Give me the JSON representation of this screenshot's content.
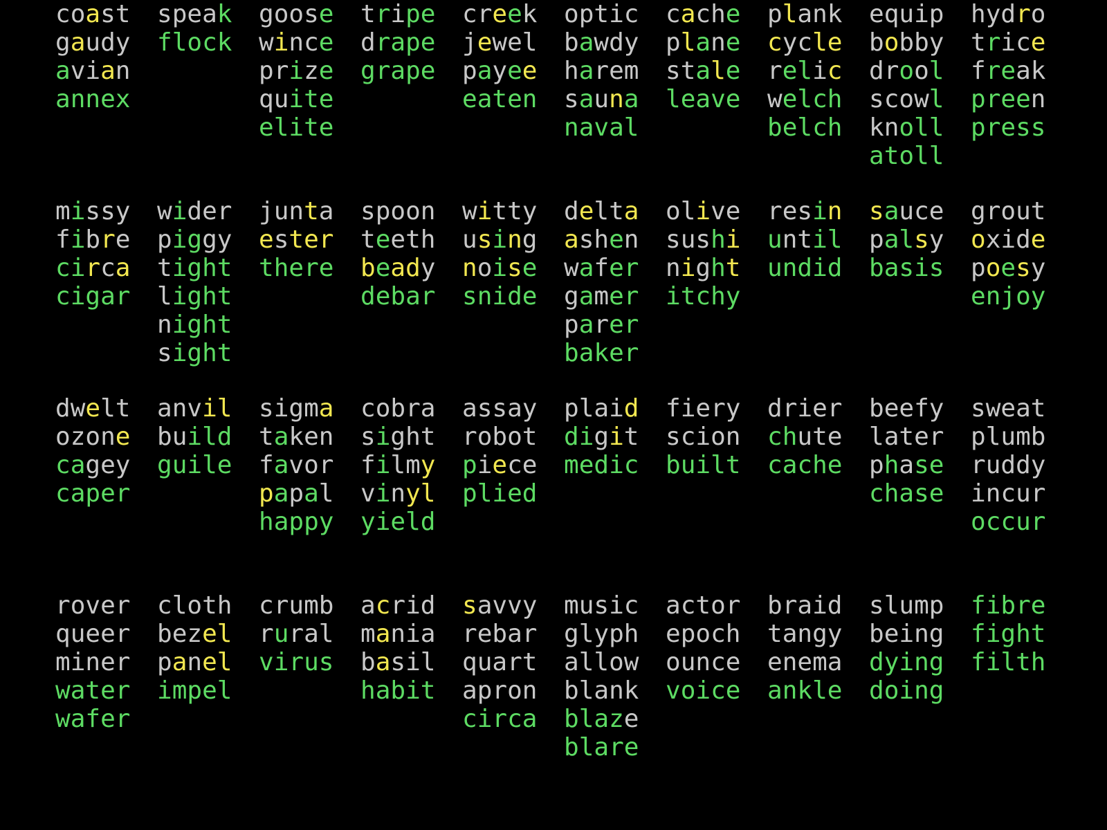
{
  "app": {
    "type": "wordle-solver-word-grid",
    "background_color": "#000000",
    "columns_per_block": 10,
    "blocks": 4
  },
  "legend": {
    "green_color": "#5ddb63",
    "yellow_color": "#f2e750",
    "gray_color": "#c8c8c8",
    "green_meaning": "correct letter correct position",
    "yellow_meaning": "correct letter wrong position",
    "gray_meaning": "letter not in word"
  },
  "blocks": [
    {
      "index": 1,
      "columns": [
        {
          "words": [
            {
              "text": "coast",
              "marks": "nnynn"
            },
            {
              "text": "gaudy",
              "marks": "nynnn"
            },
            {
              "text": "avian",
              "marks": "gnnyn"
            },
            {
              "text": "annex",
              "marks": "ggggg"
            }
          ]
        },
        {
          "words": [
            {
              "text": "speak",
              "marks": "nnnng"
            },
            {
              "text": "flock",
              "marks": "ggggg"
            }
          ]
        },
        {
          "words": [
            {
              "text": "goose",
              "marks": "nnnng"
            },
            {
              "text": "wince",
              "marks": "nynng"
            },
            {
              "text": "prize",
              "marks": "nngng"
            },
            {
              "text": "quite",
              "marks": "nnggg"
            },
            {
              "text": "elite",
              "marks": "ggggg"
            }
          ]
        },
        {
          "words": [
            {
              "text": "tripe",
              "marks": "ngngg"
            },
            {
              "text": "drape",
              "marks": "ngggg"
            },
            {
              "text": "grape",
              "marks": "ggggg"
            }
          ]
        },
        {
          "words": [
            {
              "text": "creek",
              "marks": "nnygn"
            },
            {
              "text": "jewel",
              "marks": "nynnn"
            },
            {
              "text": "payee",
              "marks": "ngngy"
            },
            {
              "text": "eaten",
              "marks": "ggggg"
            }
          ]
        },
        {
          "words": [
            {
              "text": "optic",
              "marks": "nnnnn"
            },
            {
              "text": "bawdy",
              "marks": "ngnnn"
            },
            {
              "text": "harem",
              "marks": "ngnnn"
            },
            {
              "text": "sauna",
              "marks": "ngnyg"
            },
            {
              "text": "naval",
              "marks": "ggggg"
            }
          ]
        },
        {
          "words": [
            {
              "text": "cache",
              "marks": "nynng"
            },
            {
              "text": "plane",
              "marks": "nygng"
            },
            {
              "text": "stale",
              "marks": "nngyg"
            },
            {
              "text": "leave",
              "marks": "ggggg"
            }
          ]
        },
        {
          "words": [
            {
              "text": "plank",
              "marks": "nynnn"
            },
            {
              "text": "cycle",
              "marks": "ynnyy"
            },
            {
              "text": "relic",
              "marks": "nggny"
            },
            {
              "text": "welch",
              "marks": "ngggg"
            },
            {
              "text": "belch",
              "marks": "ggggg"
            }
          ]
        },
        {
          "words": [
            {
              "text": "equip",
              "marks": "nnnnn"
            },
            {
              "text": "bobby",
              "marks": "nynnn"
            },
            {
              "text": "drool",
              "marks": "nngng"
            },
            {
              "text": "scowl",
              "marks": "nnnng"
            },
            {
              "text": "knoll",
              "marks": "nnggg"
            },
            {
              "text": "atoll",
              "marks": "ggggg"
            }
          ]
        },
        {
          "words": [
            {
              "text": "hydro",
              "marks": "nnnyn"
            },
            {
              "text": "trice",
              "marks": "ngnny"
            },
            {
              "text": "freak",
              "marks": "nggnn"
            },
            {
              "text": "preen",
              "marks": "ggggn"
            },
            {
              "text": "press",
              "marks": "ggggg"
            }
          ]
        }
      ]
    },
    {
      "index": 2,
      "columns": [
        {
          "words": [
            {
              "text": "missy",
              "marks": "ngnnn"
            },
            {
              "text": "fibre",
              "marks": "ngnyn"
            },
            {
              "text": "circa",
              "marks": "ggyny"
            },
            {
              "text": "cigar",
              "marks": "ggggg"
            }
          ]
        },
        {
          "words": [
            {
              "text": "wider",
              "marks": "ngnnn"
            },
            {
              "text": "piggy",
              "marks": "nggnn"
            },
            {
              "text": "tight",
              "marks": "ngggg"
            },
            {
              "text": "light",
              "marks": "ngggg"
            },
            {
              "text": "night",
              "marks": "ngggg"
            },
            {
              "text": "sight",
              "marks": "ngggg"
            }
          ]
        },
        {
          "words": [
            {
              "text": "junta",
              "marks": "nnnyn"
            },
            {
              "text": "ester",
              "marks": "ynyyy"
            },
            {
              "text": "there",
              "marks": "ggggg"
            }
          ]
        },
        {
          "words": [
            {
              "text": "spoon",
              "marks": "nnnnn"
            },
            {
              "text": "teeth",
              "marks": "ngnnn"
            },
            {
              "text": "beady",
              "marks": "ygyyn"
            },
            {
              "text": "debar",
              "marks": "ggggg"
            }
          ]
        },
        {
          "words": [
            {
              "text": "witty",
              "marks": "nynnn"
            },
            {
              "text": "using",
              "marks": "nygyn"
            },
            {
              "text": "noise",
              "marks": "yngyg"
            },
            {
              "text": "snide",
              "marks": "ggggg"
            }
          ]
        },
        {
          "words": [
            {
              "text": "delta",
              "marks": "nynny"
            },
            {
              "text": "ashen",
              "marks": "ynngn"
            },
            {
              "text": "wafer",
              "marks": "ngngg"
            },
            {
              "text": "gamer",
              "marks": "ngngg"
            },
            {
              "text": "parer",
              "marks": "ngngg"
            },
            {
              "text": "baker",
              "marks": "ggggg"
            }
          ]
        },
        {
          "words": [
            {
              "text": "olive",
              "marks": "nnynn"
            },
            {
              "text": "sushi",
              "marks": "nnngy"
            },
            {
              "text": "night",
              "marks": "nyngy"
            },
            {
              "text": "itchy",
              "marks": "ggggg"
            }
          ]
        },
        {
          "words": [
            {
              "text": "resin",
              "marks": "nnngy"
            },
            {
              "text": "until",
              "marks": "gnngg"
            },
            {
              "text": "undid",
              "marks": "ggggg"
            }
          ]
        },
        {
          "words": [
            {
              "text": "sauce",
              "marks": "ygnnn"
            },
            {
              "text": "palsy",
              "marks": "nggyn"
            },
            {
              "text": "basis",
              "marks": "ggggg"
            }
          ]
        },
        {
          "words": [
            {
              "text": "grout",
              "marks": "nnnnn"
            },
            {
              "text": "oxide",
              "marks": "ynnny"
            },
            {
              "text": "poesy",
              "marks": "nygyn"
            },
            {
              "text": "enjoy",
              "marks": "ggggg"
            }
          ]
        }
      ]
    },
    {
      "index": 3,
      "columns": [
        {
          "words": [
            {
              "text": "dwelt",
              "marks": "nnynn"
            },
            {
              "text": "ozone",
              "marks": "nnnny"
            },
            {
              "text": "cagey",
              "marks": "ggnnn"
            },
            {
              "text": "caper",
              "marks": "ggggg"
            }
          ]
        },
        {
          "words": [
            {
              "text": "anvil",
              "marks": "nnnyy"
            },
            {
              "text": "build",
              "marks": "nnggg"
            },
            {
              "text": "guile",
              "marks": "ggggg"
            }
          ]
        },
        {
          "words": [
            {
              "text": "sigma",
              "marks": "nnnny"
            },
            {
              "text": "taken",
              "marks": "ngnnn"
            },
            {
              "text": "favor",
              "marks": "ngnnn"
            },
            {
              "text": "papal",
              "marks": "ygngn"
            },
            {
              "text": "happy",
              "marks": "ggggg"
            }
          ]
        },
        {
          "words": [
            {
              "text": "cobra",
              "marks": "nnnnn"
            },
            {
              "text": "sight",
              "marks": "ngnnn"
            },
            {
              "text": "filmy",
              "marks": "ngnny"
            },
            {
              "text": "vinyl",
              "marks": "ngnyy"
            },
            {
              "text": "yield",
              "marks": "ggggg"
            }
          ]
        },
        {
          "words": [
            {
              "text": "assay",
              "marks": "nnnnn"
            },
            {
              "text": "robot",
              "marks": "nnnnn"
            },
            {
              "text": "piece",
              "marks": "gnynn"
            },
            {
              "text": "plied",
              "marks": "ggggg"
            }
          ]
        },
        {
          "words": [
            {
              "text": "plaid",
              "marks": "nnnny"
            },
            {
              "text": "digit",
              "marks": "ggnyn"
            },
            {
              "text": "medic",
              "marks": "ggggg"
            }
          ]
        },
        {
          "words": [
            {
              "text": "fiery",
              "marks": "nnnnn"
            },
            {
              "text": "scion",
              "marks": "nnnnn"
            },
            {
              "text": "built",
              "marks": "ggggg"
            }
          ]
        },
        {
          "words": [
            {
              "text": "drier",
              "marks": "nnnnn"
            },
            {
              "text": "chute",
              "marks": "ggnnn"
            },
            {
              "text": "cache",
              "marks": "ggggg"
            }
          ]
        },
        {
          "words": [
            {
              "text": "beefy",
              "marks": "nnnnn"
            },
            {
              "text": "later",
              "marks": "nnnnn"
            },
            {
              "text": "phase",
              "marks": "ngngg"
            },
            {
              "text": "chase",
              "marks": "ggggg"
            }
          ]
        },
        {
          "words": [
            {
              "text": "sweat",
              "marks": "nnnnn"
            },
            {
              "text": "plumb",
              "marks": "nnnnn"
            },
            {
              "text": "ruddy",
              "marks": "nnnnn"
            },
            {
              "text": "incur",
              "marks": "nnnnn"
            },
            {
              "text": "occur",
              "marks": "ggggg"
            }
          ]
        }
      ]
    },
    {
      "index": 4,
      "columns": [
        {
          "words": [
            {
              "text": "rover",
              "marks": "nnnnn"
            },
            {
              "text": "queer",
              "marks": "nnnnn"
            },
            {
              "text": "miner",
              "marks": "nnnnn"
            },
            {
              "text": "water",
              "marks": "ggggg"
            },
            {
              "text": "wafer",
              "marks": "ggggg"
            }
          ]
        },
        {
          "words": [
            {
              "text": "cloth",
              "marks": "nnnnn"
            },
            {
              "text": "bezel",
              "marks": "nnnyy"
            },
            {
              "text": "panel",
              "marks": "nynyy"
            },
            {
              "text": "impel",
              "marks": "ggggg"
            }
          ]
        },
        {
          "words": [
            {
              "text": "crumb",
              "marks": "nnnnn"
            },
            {
              "text": "rural",
              "marks": "ngnnn"
            },
            {
              "text": "virus",
              "marks": "ggggg"
            }
          ]
        },
        {
          "words": [
            {
              "text": "acrid",
              "marks": "nynnn"
            },
            {
              "text": "mania",
              "marks": "nynnn"
            },
            {
              "text": "basil",
              "marks": "nynnn"
            },
            {
              "text": "habit",
              "marks": "ggggg"
            }
          ]
        },
        {
          "words": [
            {
              "text": "savvy",
              "marks": "ynnnn"
            },
            {
              "text": "rebar",
              "marks": "nnnnn"
            },
            {
              "text": "quart",
              "marks": "nnnnn"
            },
            {
              "text": "apron",
              "marks": "nnnnn"
            },
            {
              "text": "circa",
              "marks": "ggggg"
            }
          ]
        },
        {
          "words": [
            {
              "text": "music",
              "marks": "nnnnn"
            },
            {
              "text": "glyph",
              "marks": "nnnnn"
            },
            {
              "text": "allow",
              "marks": "nnnnn"
            },
            {
              "text": "blank",
              "marks": "nnnnn"
            },
            {
              "text": "blaze",
              "marks": "ggggn"
            },
            {
              "text": "blare",
              "marks": "ggggg"
            }
          ]
        },
        {
          "words": [
            {
              "text": "actor",
              "marks": "nnnnn"
            },
            {
              "text": "epoch",
              "marks": "nnnnn"
            },
            {
              "text": "ounce",
              "marks": "nnnnn"
            },
            {
              "text": "voice",
              "marks": "ggggg"
            }
          ]
        },
        {
          "words": [
            {
              "text": "braid",
              "marks": "nnnnn"
            },
            {
              "text": "tangy",
              "marks": "nnnnn"
            },
            {
              "text": "enema",
              "marks": "nnnnn"
            },
            {
              "text": "ankle",
              "marks": "ggggg"
            }
          ]
        },
        {
          "words": [
            {
              "text": "slump",
              "marks": "nnnnn"
            },
            {
              "text": "being",
              "marks": "nnnnn"
            },
            {
              "text": "dying",
              "marks": "ggggg"
            },
            {
              "text": "doing",
              "marks": "ggggg"
            }
          ]
        },
        {
          "words": [
            {
              "text": "fibre",
              "marks": "ggggg"
            },
            {
              "text": "fight",
              "marks": "ggggg"
            },
            {
              "text": "filth",
              "marks": "ggggg"
            }
          ]
        }
      ]
    }
  ]
}
